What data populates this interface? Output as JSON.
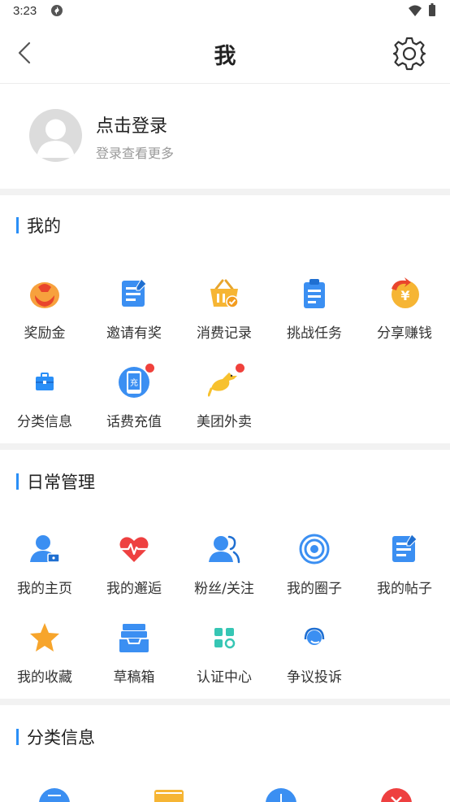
{
  "status_bar": {
    "time": "3:23"
  },
  "nav": {
    "title": "我"
  },
  "profile": {
    "login_title": "点击登录",
    "login_subtitle": "登录查看更多"
  },
  "sections": {
    "mine": {
      "title": "我的",
      "items": [
        {
          "label": "奖励金",
          "icon": "reward-bag-icon"
        },
        {
          "label": "邀请有奖",
          "icon": "invite-form-icon"
        },
        {
          "label": "消费记录",
          "icon": "shopping-basket-icon"
        },
        {
          "label": "挑战任务",
          "icon": "clipboard-icon"
        },
        {
          "label": "分享赚钱",
          "icon": "share-coin-icon"
        },
        {
          "label": "分类信息",
          "icon": "briefcase-icon"
        },
        {
          "label": "话费充值",
          "icon": "phone-recharge-icon",
          "badge": true
        },
        {
          "label": "美团外卖",
          "icon": "kangaroo-icon",
          "badge": true
        }
      ]
    },
    "daily": {
      "title": "日常管理",
      "items": [
        {
          "label": "我的主页",
          "icon": "user-home-icon"
        },
        {
          "label": "我的邂逅",
          "icon": "heart-pulse-icon"
        },
        {
          "label": "粉丝/关注",
          "icon": "followers-icon"
        },
        {
          "label": "我的圈子",
          "icon": "circle-target-icon"
        },
        {
          "label": "我的帖子",
          "icon": "post-edit-icon"
        },
        {
          "label": "我的收藏",
          "icon": "star-icon"
        },
        {
          "label": "草稿箱",
          "icon": "drafts-tray-icon"
        },
        {
          "label": "认证中心",
          "icon": "certification-blocks-icon"
        },
        {
          "label": "争议投诉",
          "icon": "headset-icon"
        }
      ]
    },
    "classified": {
      "title": "分类信息"
    }
  },
  "colors": {
    "accent": "#2a8ff7",
    "badge": "#f0413c"
  }
}
